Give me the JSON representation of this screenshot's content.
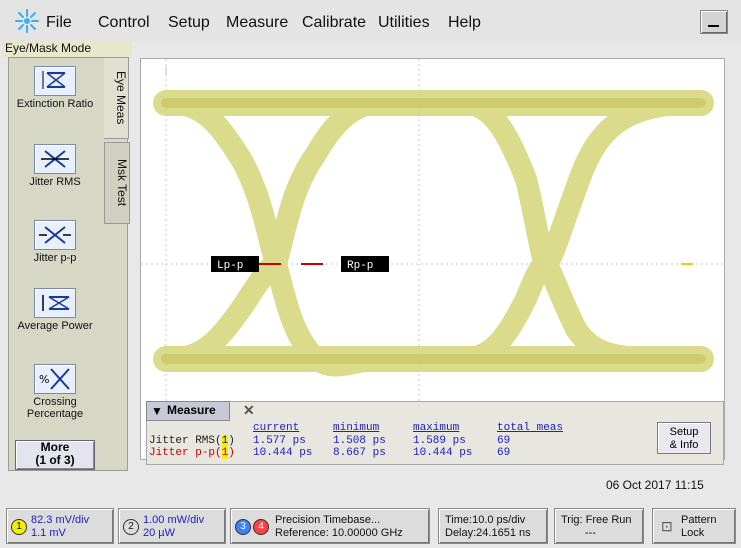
{
  "menu": {
    "items": [
      "File",
      "Control",
      "Setup",
      "Measure",
      "Calibrate",
      "Utilities",
      "Help"
    ]
  },
  "mode_label": "Eye/Mask Mode",
  "left_panel": {
    "tabs": {
      "eye_meas": "Eye Meas",
      "msk_test": "Msk Test"
    },
    "buttons": [
      {
        "label": "Extinction Ratio",
        "icon": "extinction-ratio-icon"
      },
      {
        "label": "Jitter RMS",
        "icon": "jitter-rms-icon"
      },
      {
        "label": "Jitter p-p",
        "icon": "jitter-pp-icon"
      },
      {
        "label": "Average Power",
        "icon": "average-power-icon"
      },
      {
        "label": "Crossing Percentage",
        "icon": "crossing-percentage-icon"
      }
    ],
    "more": {
      "line1": "More",
      "line2": "(1 of 3)"
    }
  },
  "markers": {
    "left": "Lp-p",
    "right": "Rp-p"
  },
  "measure_panel": {
    "title": "Measure",
    "headers": [
      "current",
      "minimum",
      "maximum",
      "total meas"
    ],
    "rows": [
      {
        "name": "Jitter RMS(",
        "chan": "1",
        "close": ")",
        "values": [
          "1.577 ps",
          "1.508 ps",
          "1.589 ps",
          "69"
        ]
      },
      {
        "name": "Jitter p-p(",
        "chan": "1",
        "close": ")",
        "values": [
          "10.444 ps",
          "8.667 ps",
          "10.444 ps",
          "69"
        ]
      }
    ],
    "setup_button": {
      "line1": "Setup",
      "line2": "& Info"
    }
  },
  "datetime": "06 Oct 2017  11:15",
  "bottom": {
    "ch1": {
      "num": "1",
      "line1": "82.3 mV/div",
      "line2": "1.1 mV"
    },
    "ch2": {
      "num": "2",
      "line1": "1.00 mW/div",
      "line2": "20 µW"
    },
    "ch34": {
      "num3": "3",
      "num4": "4",
      "line1": "Precision Timebase...",
      "line2": "Reference: 10.00000 GHz"
    },
    "time": {
      "line1": "Time:10.0 ps/div",
      "line2": "Delay:24.1651 ns"
    },
    "trig": {
      "line1": "Trig: Free Run",
      "line2": "---"
    },
    "pattern": {
      "line1": "Pattern",
      "line2": "Lock"
    }
  },
  "colors": {
    "eye": "#d8d880",
    "eye_dense": "#c8c860",
    "marker": "#cc0000",
    "ch1": "#f0f000",
    "ch3": "#4080ff",
    "ch4": "#ff4040",
    "meas_blue": "#2020c0",
    "meas_red": "#cc0000"
  }
}
